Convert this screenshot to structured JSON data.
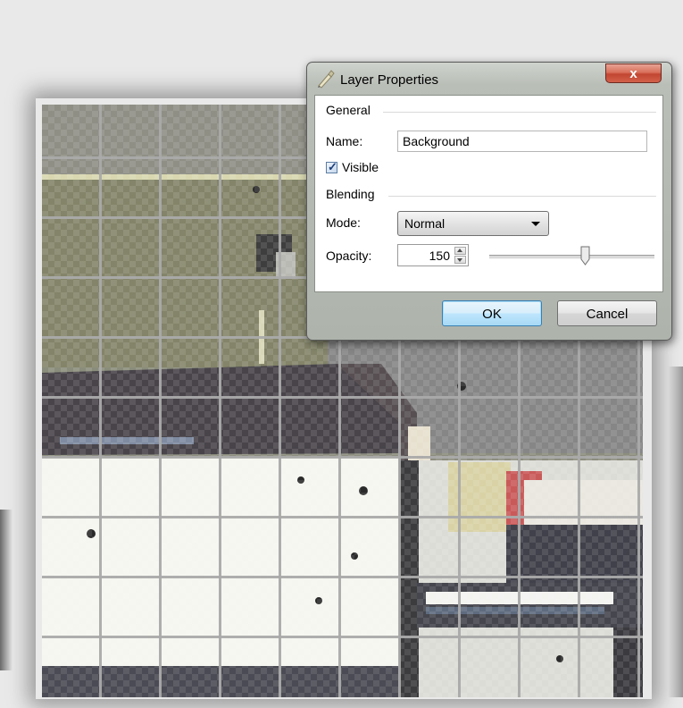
{
  "dialog": {
    "title": "Layer Properties",
    "close_label": "x",
    "general_group": "General",
    "name_label": "Name:",
    "name_value": "Background",
    "visible_label": "Visible",
    "visible_checked": true,
    "blending_group": "Blending",
    "mode_label": "Mode:",
    "mode_value": "Normal",
    "opacity_label": "Opacity:",
    "opacity_value": "150",
    "opacity_max": 255,
    "ok_label": "OK",
    "cancel_label": "Cancel"
  },
  "icons": {
    "title_icon": "layer-properties-icon",
    "checkbox_check": "checkmark-icon",
    "dropdown_arrow": "chevron-down-icon",
    "spin_up": "spin-up-icon",
    "spin_down": "spin-down-icon"
  },
  "colors": {
    "close_button": "#c94a35",
    "ok_border": "#3c7fb1",
    "dialog_frame": "#b9beb7"
  }
}
